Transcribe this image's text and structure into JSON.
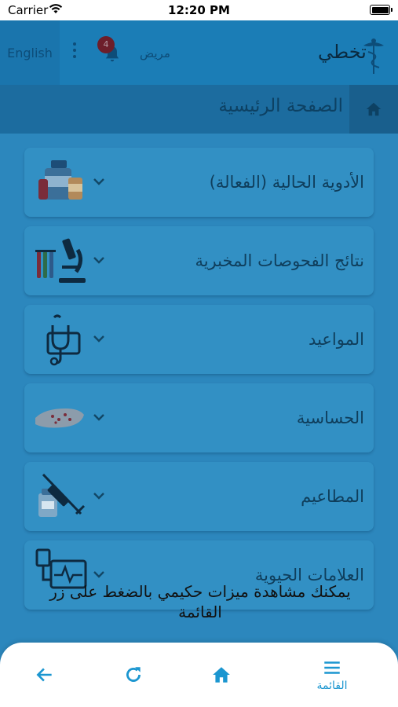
{
  "status_bar": {
    "carrier": "Carrier",
    "time": "12:20 PM"
  },
  "header": {
    "language_button": "English",
    "notification_count": "4",
    "role_label": "مريض",
    "brand_name": "تخطي"
  },
  "breadcrumb": {
    "title": "الصفحة الرئيسية"
  },
  "cards": [
    {
      "title": "الأدوية الحالية (الفعالة)",
      "icon": "medicine-bottles-icon"
    },
    {
      "title": "نتائج الفحوصات المخبرية",
      "icon": "microscope-icon"
    },
    {
      "title": "المواعيد",
      "icon": "stethoscope-icon"
    },
    {
      "title": "الحساسية",
      "icon": "allergy-icon"
    },
    {
      "title": "المطاعيم",
      "icon": "syringe-icon"
    },
    {
      "title": "العلامات الحيوية",
      "icon": "vital-monitor-icon"
    }
  ],
  "tooltip": {
    "text": "يمكنك مشاهدة ميزات حكيمي بالضغط على زر القائمة"
  },
  "bottom_nav": {
    "menu_label": "القائمة"
  },
  "colors": {
    "accent": "#1b96d0",
    "header": "#1b7db6",
    "badge": "#6d1e2a"
  }
}
